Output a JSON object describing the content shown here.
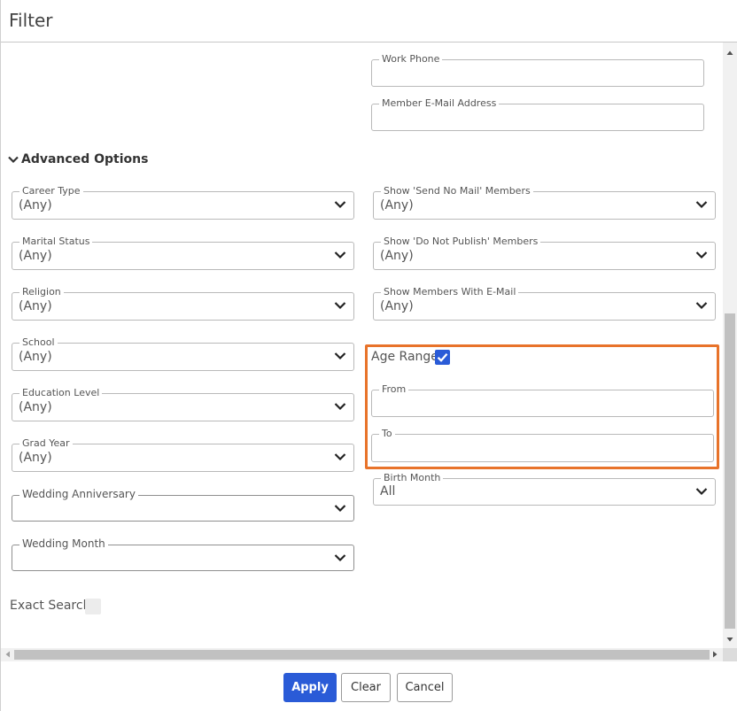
{
  "window": {
    "title": "Filter"
  },
  "contact": {
    "work_phone": {
      "label": "Work Phone",
      "value": ""
    },
    "email": {
      "label": "Member E-Mail Address",
      "value": ""
    }
  },
  "advanced": {
    "title": "Advanced Options",
    "career_type": {
      "label": "Career Type",
      "value": "(Any)"
    },
    "marital_status": {
      "label": "Marital Status",
      "value": "(Any)"
    },
    "religion": {
      "label": "Religion",
      "value": "(Any)"
    },
    "school": {
      "label": "School",
      "value": "(Any)"
    },
    "education_level": {
      "label": "Education Level",
      "value": "(Any)"
    },
    "grad_year": {
      "label": "Grad Year",
      "value": "(Any)"
    },
    "wedding_anniversary": {
      "label": "Wedding Anniversary",
      "value": ""
    },
    "wedding_month": {
      "label": "Wedding Month",
      "value": ""
    },
    "send_no_mail": {
      "label": "Show 'Send No Mail' Members",
      "value": "(Any)"
    },
    "do_not_publish": {
      "label": "Show 'Do Not Publish' Members",
      "value": "(Any)"
    },
    "with_email": {
      "label": "Show Members With E-Mail",
      "value": "(Any)"
    },
    "age_range": {
      "label": "Age Range",
      "checked": true,
      "from_label": "From",
      "to_label": "To",
      "from_value": "",
      "to_value": ""
    },
    "birth_month": {
      "label": "Birth Month",
      "value": "All"
    }
  },
  "exact_search": {
    "label": "Exact Search",
    "checked": false
  },
  "buttons": {
    "apply": "Apply",
    "clear": "Clear",
    "cancel": "Cancel"
  },
  "colors": {
    "accent": "#2a5bd7",
    "highlight": "#e8732a"
  }
}
